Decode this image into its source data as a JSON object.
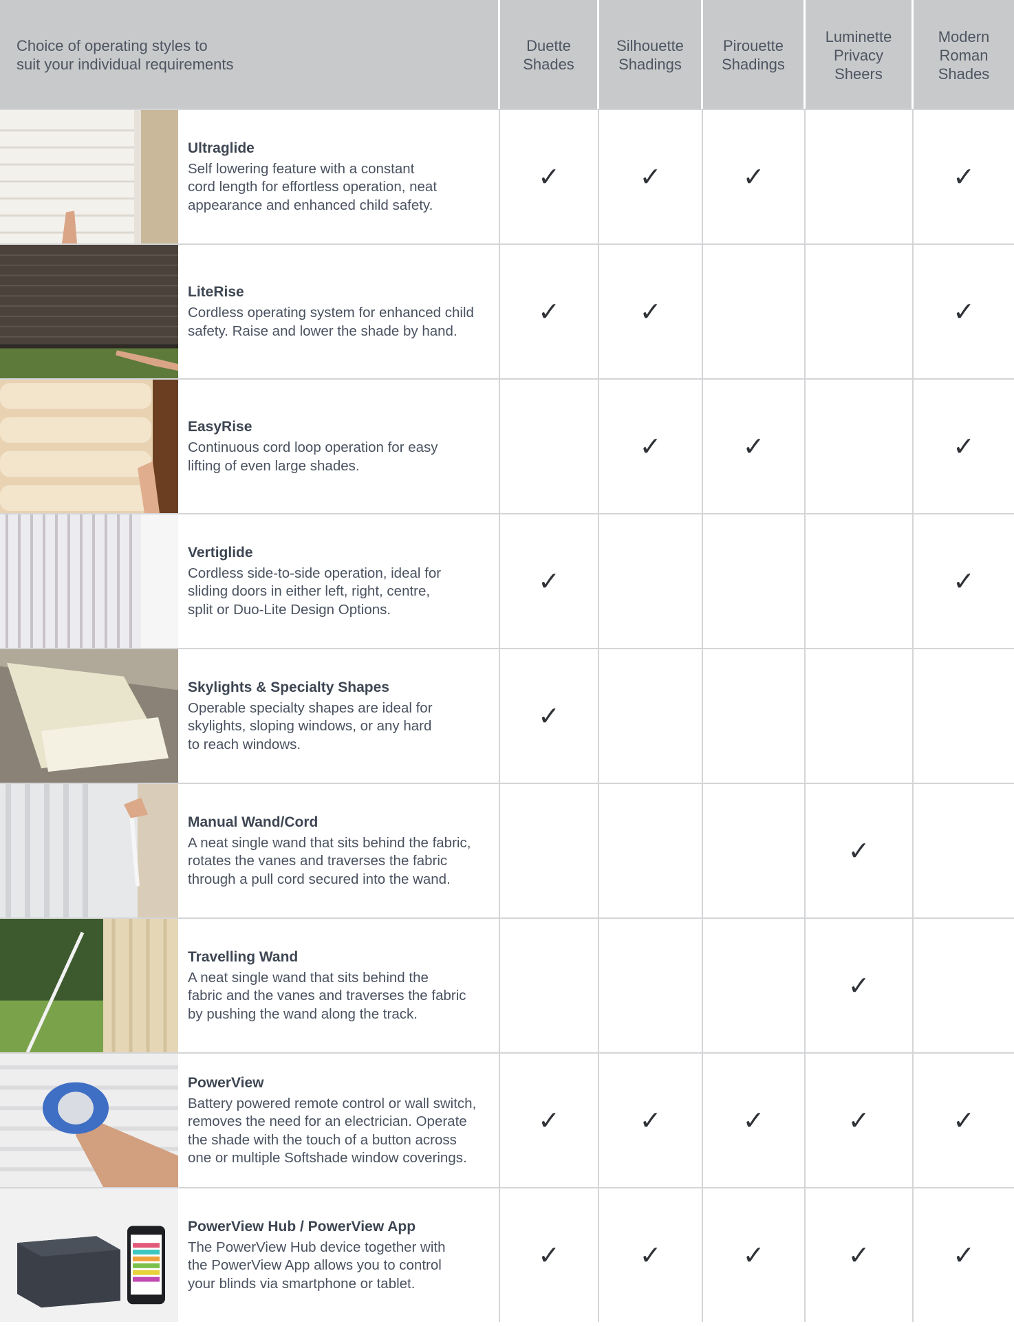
{
  "header": {
    "intro": "Choice of operating styles to\nsuit your individual requirements",
    "columns": [
      "Duette\nShades",
      "Silhouette\nShadings",
      "Pirouette\nShadings",
      "Luminette\nPrivacy\nSheers",
      "Modern\nRoman\nShades"
    ]
  },
  "check_symbol": "✓",
  "rows": [
    {
      "title": "Ultraglide",
      "text": "Self lowering feature with a constant\ncord length for effortless operation, neat\nappearance and enhanced child safety.",
      "image": "white-sheer-shade-hand-icon",
      "checks": [
        true,
        true,
        true,
        false,
        true
      ]
    },
    {
      "title": "LiteRise",
      "text": "Cordless operating system for enhanced child\nsafety. Raise and lower the shade by hand.",
      "image": "cellular-shade-hand-icon",
      "checks": [
        true,
        true,
        false,
        false,
        true
      ]
    },
    {
      "title": "EasyRise",
      "text": "Continuous cord loop operation for easy\nlifting of even large shades.",
      "image": "roman-shade-cord-icon",
      "checks": [
        false,
        true,
        true,
        false,
        true
      ]
    },
    {
      "title": "Vertiglide",
      "text": "Cordless side-to-side operation, ideal for\nsliding doors in either left, right, centre,\nsplit or Duo-Lite Design Options.",
      "image": "vertical-cellular-shade-icon",
      "checks": [
        true,
        false,
        false,
        false,
        true
      ]
    },
    {
      "title": "Skylights & Specialty Shapes",
      "text": "Operable specialty shapes are ideal for\nskylights, sloping windows, or any hard\nto reach windows.",
      "image": "skylight-shade-icon",
      "checks": [
        true,
        false,
        false,
        false,
        false
      ]
    },
    {
      "title": "Manual Wand/Cord",
      "text": "A neat single wand that sits behind the fabric,\nrotates the vanes and traverses the fabric\nthrough a pull cord secured into the wand.",
      "image": "vertical-sheer-wand-icon",
      "checks": [
        false,
        false,
        false,
        true,
        false
      ]
    },
    {
      "title": "Travelling Wand",
      "text": "A neat single wand that sits behind the\nfabric and the vanes and traverses the fabric\nby pushing the wand along the track.",
      "image": "travelling-wand-garden-icon",
      "checks": [
        false,
        false,
        false,
        true,
        false
      ]
    },
    {
      "title": "PowerView",
      "text": "Battery powered remote control or wall switch,\nremoves the need for an electrician. Operate\nthe shade with the touch of a button across\none or multiple Softshade window coverings.",
      "image": "blue-remote-control-icon",
      "checks": [
        true,
        true,
        true,
        true,
        true
      ]
    },
    {
      "title": "PowerView Hub / PowerView App",
      "text": "The PowerView Hub device together with\nthe PowerView App allows you to control\nyour blinds via smartphone or tablet.",
      "image": "hub-and-smartphone-icon",
      "checks": [
        true,
        true,
        true,
        true,
        true
      ]
    }
  ]
}
